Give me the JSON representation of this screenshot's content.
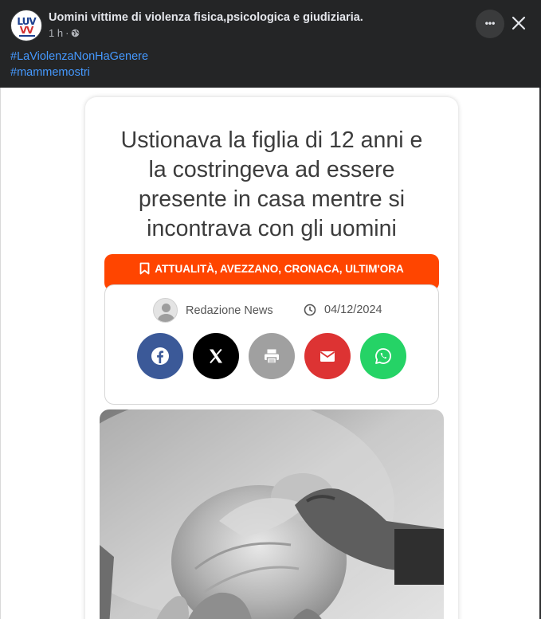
{
  "post": {
    "page_name": "Uomini vittime di violenza fisica,psicologica e giudiziaria.",
    "avatar_logo": {
      "line1": "LUV",
      "line2": "VV"
    },
    "time": "1 h",
    "separator": "·",
    "hashtags": [
      "#LaViolenzaNonHaGenere",
      "#mammemostri"
    ],
    "more_label": "•••",
    "icons": {
      "globe": "globe-icon",
      "close": "close-icon",
      "more": "more-options-icon"
    }
  },
  "article": {
    "headline_lines": [
      "Ustionava la figlia di 12 anni e",
      "la costringeva ad essere",
      "presente in casa mentre si",
      "incontrava con gli uomini"
    ],
    "categories": "ATTUALITÀ, AVEZZANO, CRONACA, ULTIM'ORA",
    "author": "Redazione News",
    "date": "04/12/2024",
    "share_buttons": [
      {
        "name": "facebook",
        "icon": "facebook-icon",
        "color": "#3b5998"
      },
      {
        "name": "x",
        "icon": "x-icon",
        "color": "#000000"
      },
      {
        "name": "print",
        "icon": "print-icon",
        "color": "#a0a0a0"
      },
      {
        "name": "email",
        "icon": "email-icon",
        "color": "#dd3333"
      },
      {
        "name": "whatsapp",
        "icon": "whatsapp-icon",
        "color": "#25d366"
      }
    ]
  },
  "colors": {
    "background": "#242526",
    "hashtag": "#4599ff",
    "category_bar": "#ff4500"
  }
}
